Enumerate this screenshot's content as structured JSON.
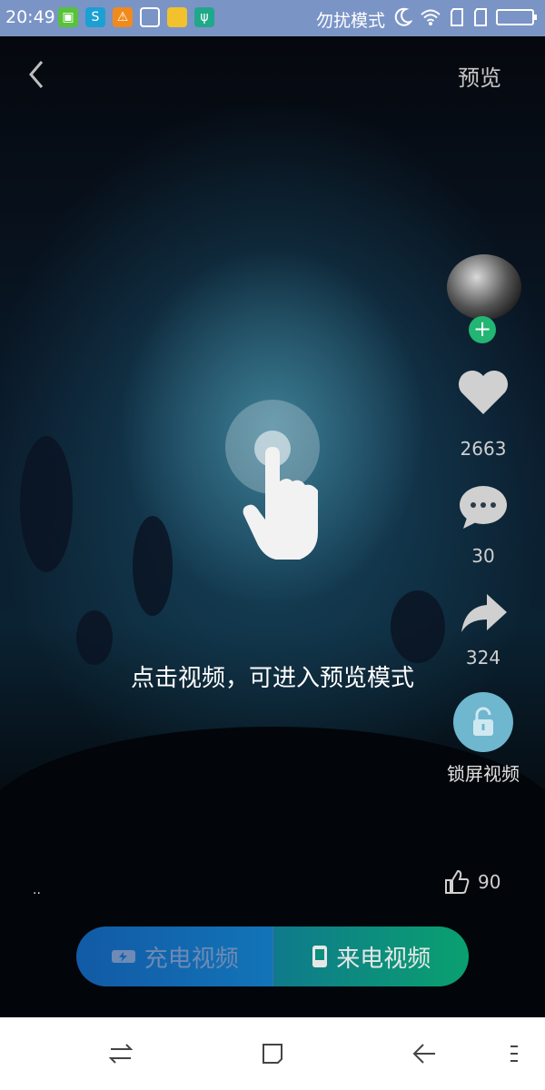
{
  "status_bar": {
    "time": "20:49",
    "mode": "勿扰模式"
  },
  "header": {
    "back_icon": "chevron-left-icon",
    "preview_label": "预览"
  },
  "actions": {
    "like_count": "2663",
    "comment_count": "30",
    "share_count": "324",
    "lock_label": "锁屏视频"
  },
  "hint": {
    "text": "点击视频，可进入预览模式"
  },
  "footer": {
    "dots": "..",
    "thumbs_count": "90"
  },
  "toggle": {
    "charging_label": "充电视频",
    "incoming_label": "来电视频"
  },
  "colors": {
    "status_bar": "#7a94c6",
    "accent_green": "#22b573",
    "tab_blue": "#125aa5",
    "tab_green": "#0aa06f"
  }
}
